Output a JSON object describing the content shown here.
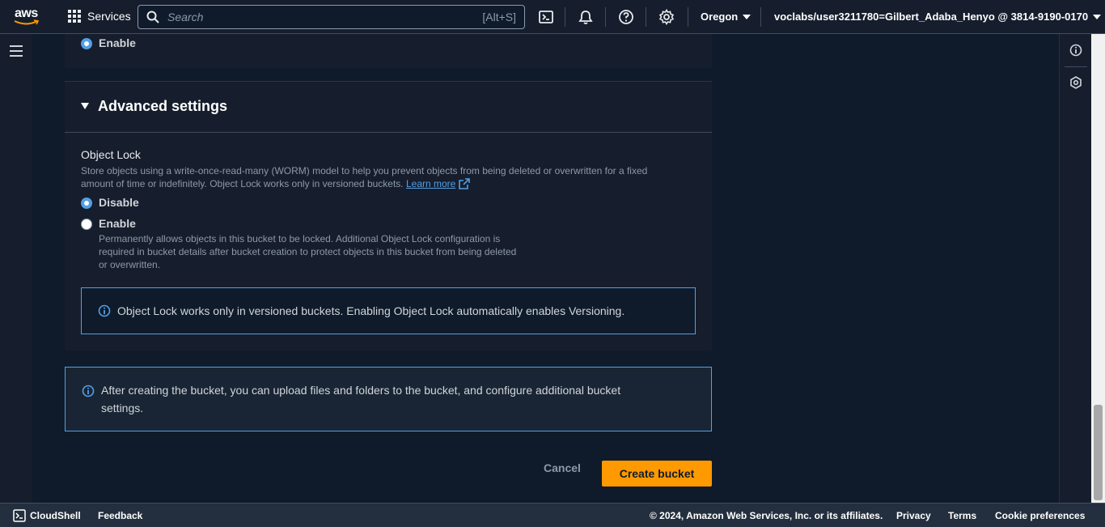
{
  "topnav": {
    "logo_text": "aws",
    "services_label": "Services",
    "search": {
      "placeholder": "Search",
      "shortcut": "[Alt+S]"
    },
    "icons": [
      "cloudshell-icon",
      "bell-icon",
      "help-icon",
      "gear-icon"
    ],
    "region_label": "Oregon",
    "account_label": "voclabs/user3211780=Gilbert_Adaba_Henyo @ 3814-9190-0170"
  },
  "main": {
    "prev_section": {
      "enable_label": "Enable"
    },
    "advanced": {
      "header": "Advanced settings",
      "object_lock": {
        "title": "Object Lock",
        "description_line1": "Store objects using a write-once-read-many (WORM) model to help you prevent objects from being deleted or overwritten for a fixed",
        "description_line2": "amount of time or indefinitely. Object Lock works only in versioned buckets.",
        "learn_more": "Learn more",
        "options": [
          {
            "label": "Disable",
            "checked": true
          },
          {
            "label": "Enable",
            "checked": false,
            "description_lines": [
              "Permanently allows objects in this bucket to be locked. Additional Object Lock configuration is",
              "required in bucket details after bucket creation to protect objects in this bucket from being deleted",
              "or overwritten."
            ]
          }
        ],
        "info_alert": "Object Lock works only in versioned buckets. Enabling Object Lock automatically enables Versioning."
      }
    },
    "after_info": {
      "line1": "After creating the bucket, you can upload files and folders to the bucket, and configure additional bucket",
      "line2": "settings."
    },
    "cancel_label": "Cancel",
    "create_label": "Create bucket"
  },
  "footer": {
    "cloudshell_label": "CloudShell",
    "feedback_label": "Feedback",
    "copyright": "© 2024, Amazon Web Services, Inc. or its affiliates.",
    "privacy_label": "Privacy",
    "terms_label": "Terms",
    "cookie_label": "Cookie preferences"
  },
  "colors": {
    "accent": "#539fe5",
    "primary_button": "#ff9900",
    "background": "#0f1b2a",
    "panel": "#161e2d"
  }
}
